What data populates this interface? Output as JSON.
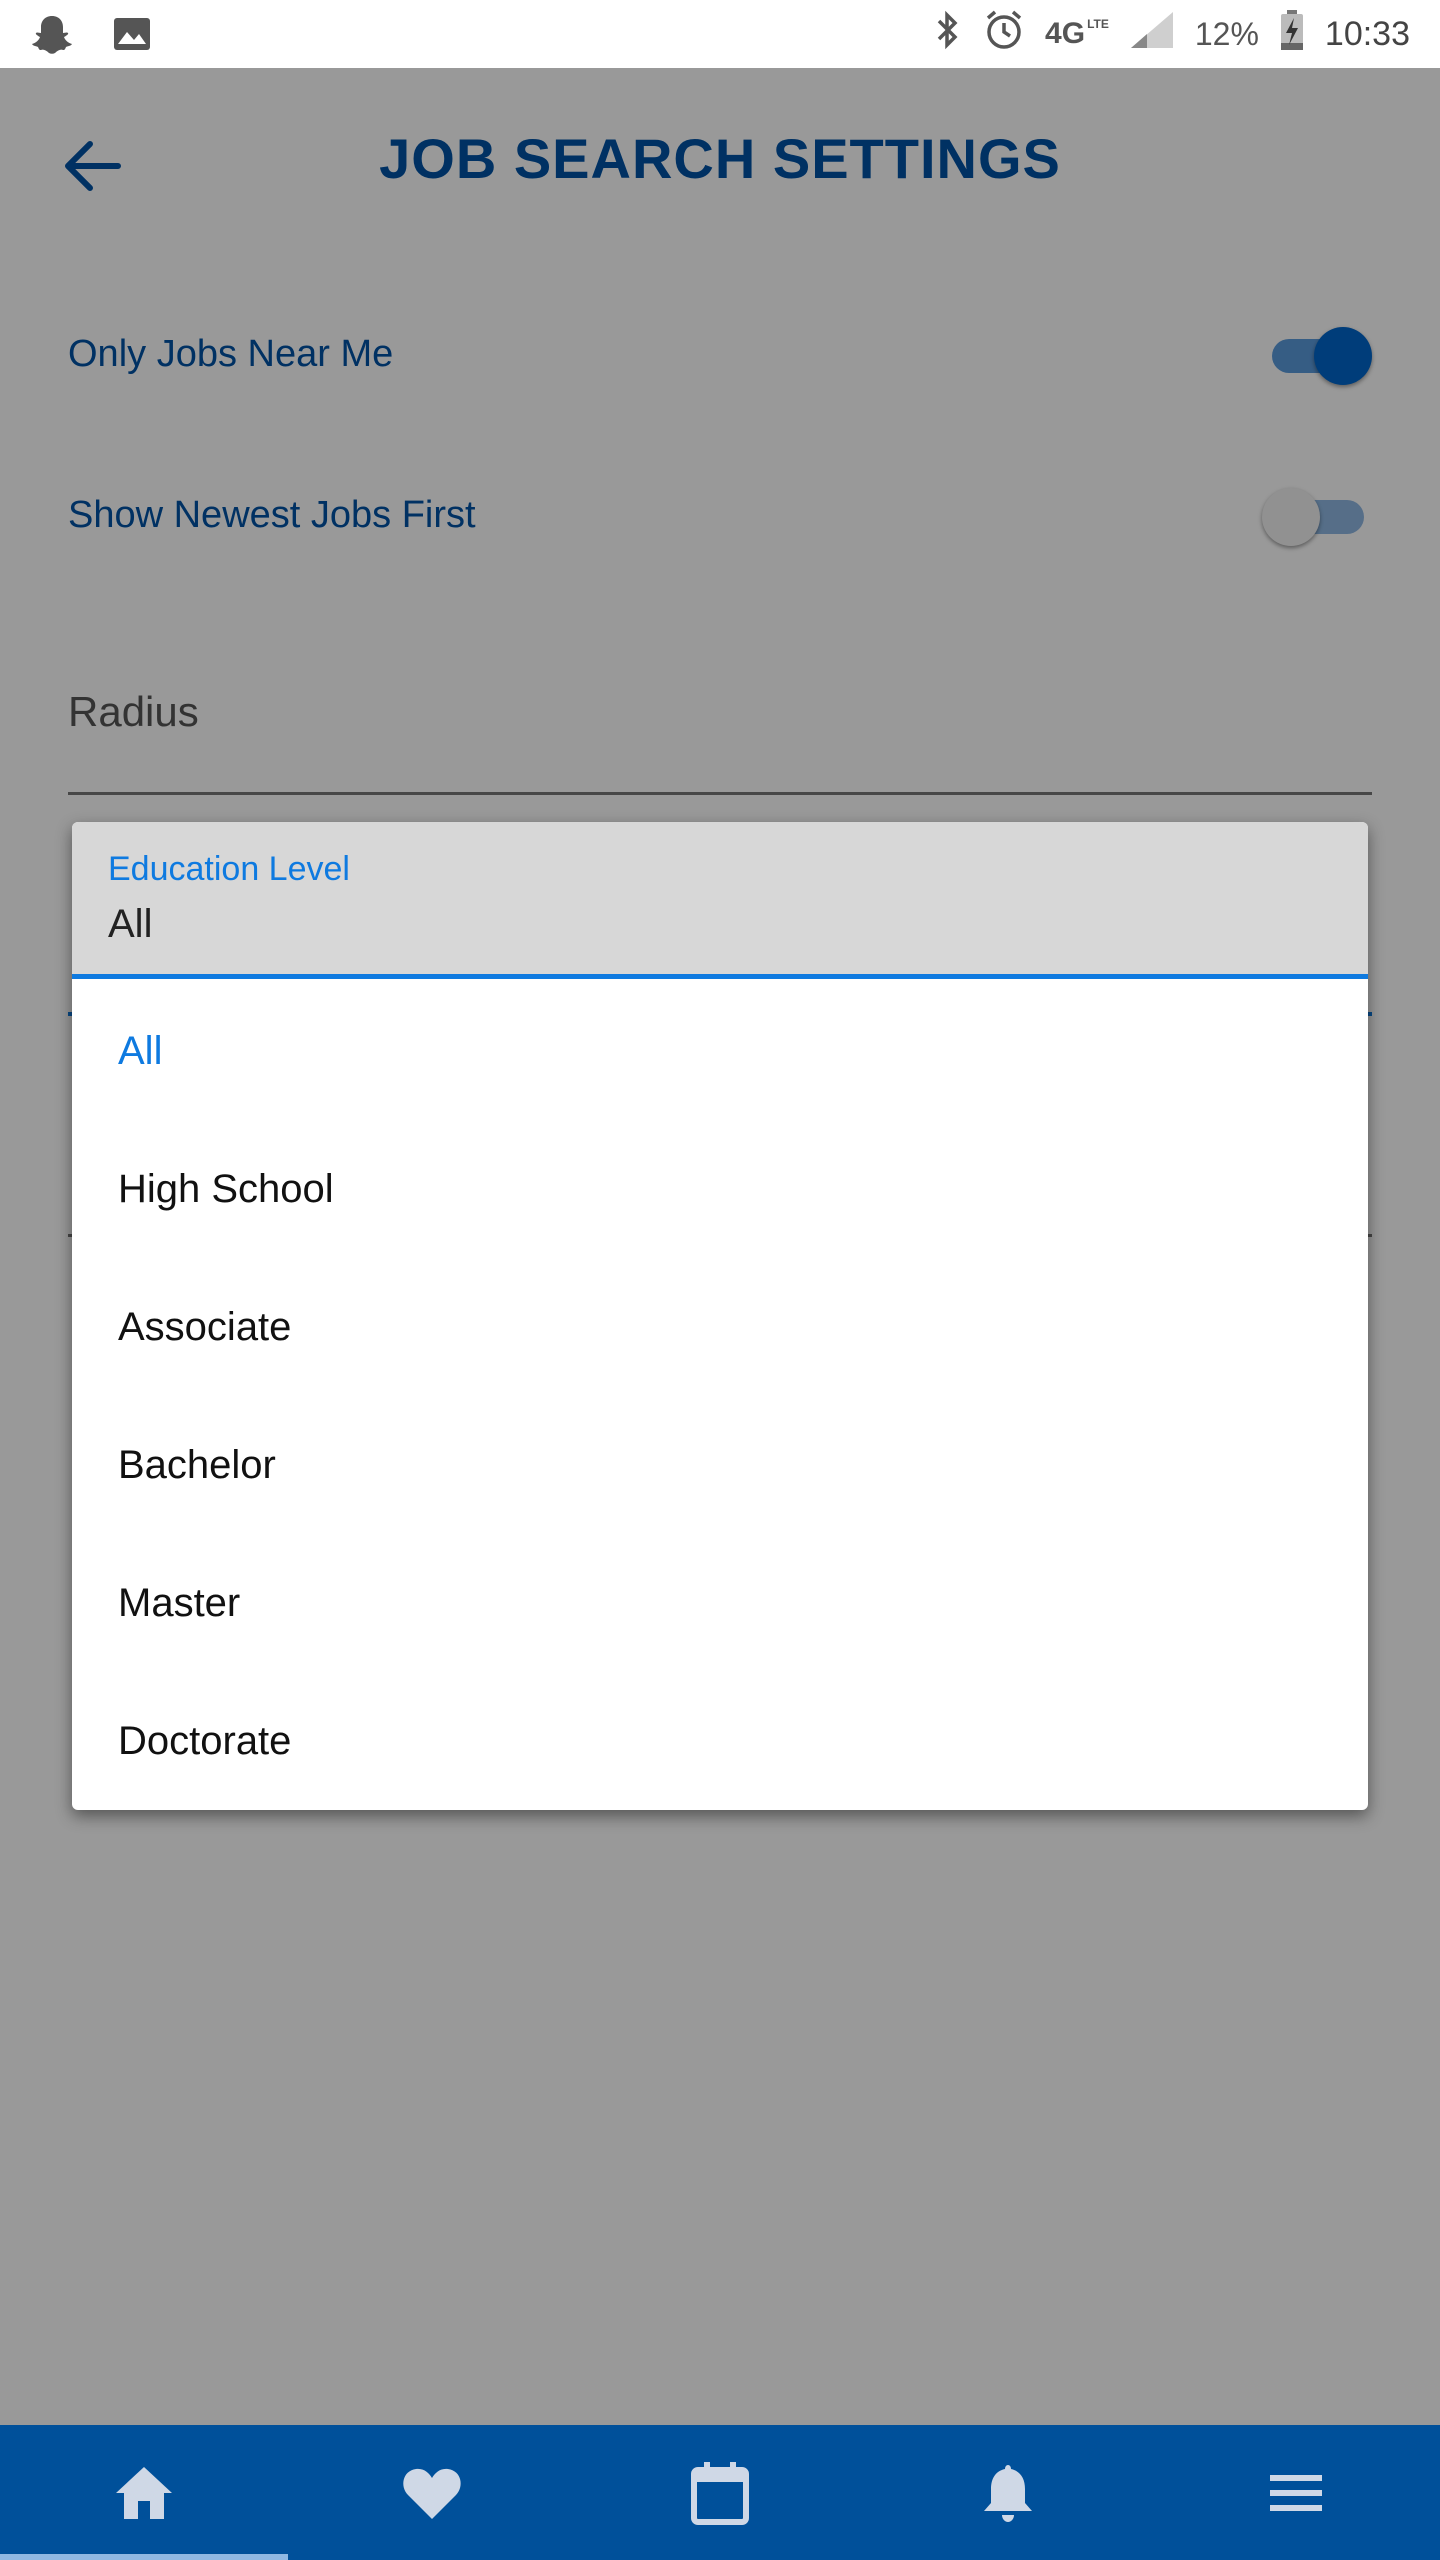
{
  "status_bar": {
    "network": "4G",
    "network_sub": "LTE",
    "battery": "12%",
    "time": "10:33"
  },
  "header": {
    "title": "JOB SEARCH SETTINGS",
    "back_icon": "arrow-back-icon"
  },
  "settings": {
    "only_jobs_near_me": {
      "label": "Only Jobs Near Me",
      "on": true
    },
    "show_newest_first": {
      "label": "Show Newest Jobs First",
      "on": false
    }
  },
  "radius": {
    "label": "Radius"
  },
  "education_dropdown": {
    "label": "Education Level",
    "value": "All",
    "options": [
      "All",
      "High School",
      "Associate",
      "Bachelor",
      "Master",
      "Doctorate"
    ],
    "selected": "All"
  },
  "bottom_nav": {
    "items": [
      {
        "icon": "home-icon",
        "active": true
      },
      {
        "icon": "heart-icon",
        "active": false
      },
      {
        "icon": "calendar-icon",
        "active": false
      },
      {
        "icon": "bell-icon",
        "active": false
      },
      {
        "icon": "menu-icon",
        "active": false
      }
    ]
  },
  "colors": {
    "primary": "#0052a5",
    "accent": "#0e7ae0",
    "nav_bg": "#00509a"
  }
}
